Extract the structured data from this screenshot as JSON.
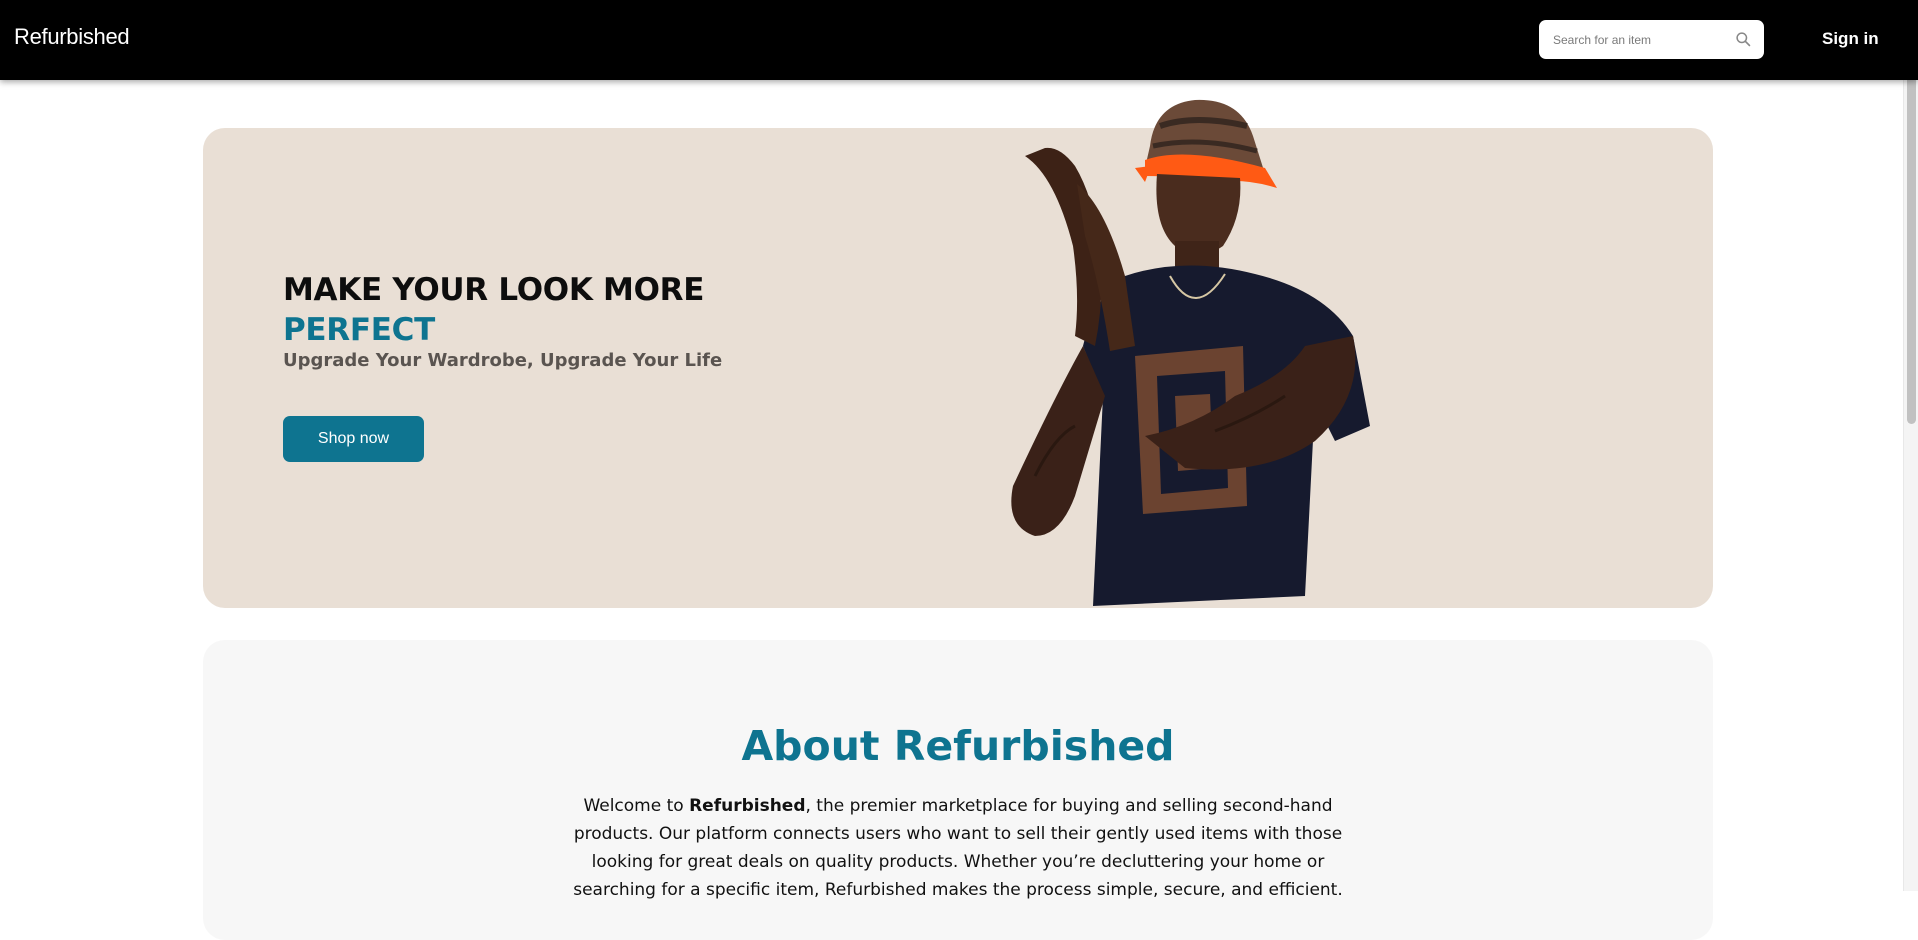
{
  "header": {
    "brand": "Refurbished",
    "search_placeholder": "Search for an item",
    "signin_label": "Sign in"
  },
  "hero": {
    "title_line1": "MAKE YOUR LOOK MORE",
    "title_line2": "PERFECT",
    "subtitle": "Upgrade Your Wardrobe, Upgrade Your Life",
    "button_label": "Shop now"
  },
  "about": {
    "title": "About Refurbished",
    "text_before": "Welcome to ",
    "text_bold": "Refurbished",
    "text_after": ", the premier marketplace for buying and selling second-hand products. Our platform connects users who want to sell their gently used items with those looking for great deals on quality products. Whether you’re decluttering your home or searching for a specific item, Refurbished makes the process simple, secure, and efficient."
  },
  "colors": {
    "navbar": "#000000",
    "accent": "#0e7490",
    "hero_bg": "#e9dfd5",
    "about_bg": "#f7f7f7"
  },
  "icons": {
    "search": "search-icon"
  }
}
